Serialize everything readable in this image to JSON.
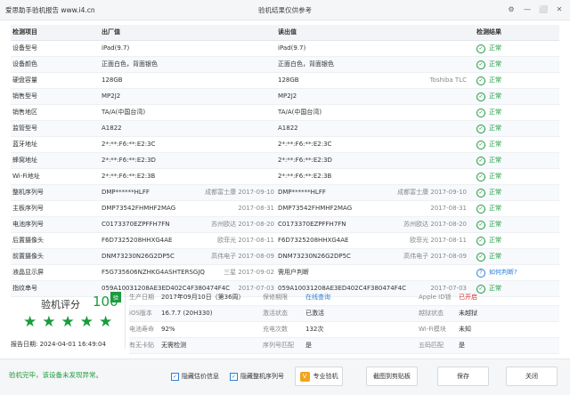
{
  "titlebar": {
    "app_title": "爱思助手验机报告 www.i4.cn",
    "center_title": "验机结果仅供参考",
    "icons": [
      "gear-icon",
      "minimize-icon",
      "restore-icon",
      "close-icon"
    ]
  },
  "table": {
    "headers": {
      "item": "检测项目",
      "factory": "出厂值",
      "read": "读出值",
      "result": "检测结果"
    },
    "rows": [
      {
        "item": "设备型号",
        "factory": "iPad(9.7)",
        "fnote": "",
        "read": "iPad(9.7)",
        "rnote": "",
        "result": "正常",
        "status": "ok"
      },
      {
        "item": "设备颜色",
        "factory": "正面白色，背面银色",
        "fnote": "",
        "read": "正面白色，背面银色",
        "rnote": "",
        "result": "正常",
        "status": "ok"
      },
      {
        "item": "硬盘容量",
        "factory": "128GB",
        "fnote": "",
        "read": "128GB",
        "rnote": "Toshiba TLC",
        "result": "正常",
        "status": "ok"
      },
      {
        "item": "销售型号",
        "factory": "MP2J2",
        "fnote": "",
        "read": "MP2J2",
        "rnote": "",
        "result": "正常",
        "status": "ok"
      },
      {
        "item": "销售地区",
        "factory": "TA/A(中国台湾)",
        "fnote": "",
        "read": "TA/A(中国台湾)",
        "rnote": "",
        "result": "正常",
        "status": "ok"
      },
      {
        "item": "监管型号",
        "factory": "A1822",
        "fnote": "",
        "read": "A1822",
        "rnote": "",
        "result": "正常",
        "status": "ok"
      },
      {
        "item": "蓝牙地址",
        "factory": "2*:**:F6:**:E2:3C",
        "fnote": "",
        "read": "2*:**:F6:**:E2:3C",
        "rnote": "",
        "result": "正常",
        "status": "ok"
      },
      {
        "item": "蜂窝地址",
        "factory": "2*:**:F6:**:E2:3D",
        "fnote": "",
        "read": "2*:**:F6:**:E2:3D",
        "rnote": "",
        "result": "正常",
        "status": "ok"
      },
      {
        "item": "Wi-Fi地址",
        "factory": "2*:**:F6:**:E2:3B",
        "fnote": "",
        "read": "2*:**:F6:**:E2:3B",
        "rnote": "",
        "result": "正常",
        "status": "ok"
      },
      {
        "item": "整机序列号",
        "factory": "DMP******HLFF",
        "fnote": "成都富士康 2017-09-10",
        "read": "DMP******HLFF",
        "rnote": "成都富士康 2017-09-10",
        "result": "正常",
        "status": "ok"
      },
      {
        "item": "主板序列号",
        "factory": "DMP73542FHMHF2MAG",
        "fnote": "2017-08-31",
        "read": "DMP73542FHMHF2MAG",
        "rnote": "2017-08-31",
        "result": "正常",
        "status": "ok"
      },
      {
        "item": "电池序列号",
        "factory": "C0173370EZPFFH7FN",
        "fnote": "苏州欧达 2017-08-20",
        "read": "C0173370EZPFFH7FN",
        "rnote": "苏州欧达 2017-08-20",
        "result": "正常",
        "status": "ok"
      },
      {
        "item": "后置摄像头",
        "factory": "F6D7325208HHXG4AE",
        "fnote": "欧菲光 2017-08-11",
        "read": "F6D7325208HHXG4AE",
        "rnote": "欧菲光 2017-08-11",
        "result": "正常",
        "status": "ok"
      },
      {
        "item": "前置摄像头",
        "factory": "DNM73230N26G2DP5C",
        "fnote": "高伟电子 2017-08-09",
        "read": "DNM73230N26G2DP5C",
        "rnote": "高伟电子 2017-08-09",
        "result": "正常",
        "status": "ok"
      },
      {
        "item": "液晶显示屏",
        "factory": "F5G735606NZHKG4ASHTERSGJQ",
        "fnote": "三星 2017-09-02",
        "read": "需用户判断",
        "rnote": "",
        "result": "如何判断?",
        "status": "help"
      },
      {
        "item": "指纹串号",
        "factory": "059A10031208AE3ED402C4F380474F4C",
        "fnote": "2017-07-03",
        "read": "059A10031208AE3ED402C4F380474F4C",
        "rnote": "2017-07-03",
        "result": "正常",
        "status": "ok"
      }
    ]
  },
  "score": {
    "title": "验机评分",
    "value": "100",
    "badge": "验",
    "stars": 5,
    "report_date_label": "报告日期:",
    "report_date": "2024-04-01 16:49:04"
  },
  "info": {
    "rows": [
      [
        {
          "k": "生产日期",
          "v": "2017年09月10日（第36周）",
          "vc": ""
        },
        {
          "k": "保修期限",
          "v": "在线查询",
          "vc": "blue"
        },
        {
          "k": "Apple ID锁",
          "v": "已开启",
          "vc": "red"
        }
      ],
      [
        {
          "k": "iOS版本",
          "v": "16.7.7 (20H330)",
          "vc": ""
        },
        {
          "k": "激活状态",
          "v": "已激活",
          "vc": ""
        },
        {
          "k": "越狱状态",
          "v": "未越狱",
          "vc": ""
        }
      ],
      [
        {
          "k": "电池寿命",
          "v": "92%",
          "vc": ""
        },
        {
          "k": "充电次数",
          "v": "132次",
          "vc": ""
        },
        {
          "k": "Wi-Fi模块",
          "v": "未知",
          "vc": ""
        }
      ],
      [
        {
          "k": "有无卡贴",
          "v": "无需检测",
          "vc": ""
        },
        {
          "k": "序列号匹配",
          "v": "是",
          "vc": ""
        },
        {
          "k": "五码匹配",
          "v": "是",
          "vc": ""
        }
      ]
    ]
  },
  "footer": {
    "status_msg": "验机完毕，该设备未发现异常。",
    "hide_price_label": "隐藏估价信息",
    "hide_serial_label": "隐藏整机序列号",
    "pro_label": "专业验机",
    "pro_icon_text": "V",
    "screenshot_label": "截图到剪贴板",
    "save_label": "保存",
    "close_label": "关闭"
  }
}
